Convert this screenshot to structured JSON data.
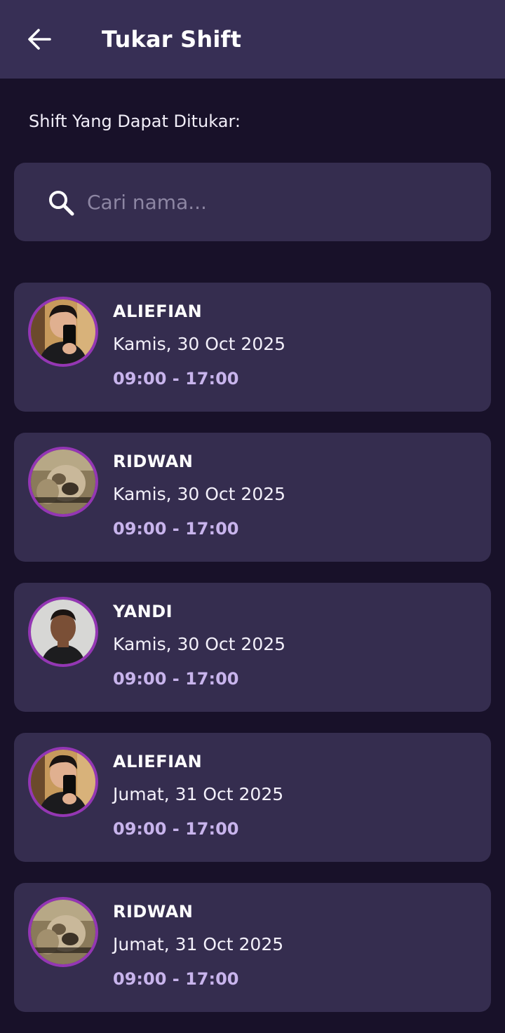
{
  "app_bar": {
    "title": "Tukar Shift",
    "back_icon": "arrow-left-icon"
  },
  "section_label": "Shift Yang Dapat Ditukar:",
  "search": {
    "placeholder": "Cari nama...",
    "value": "",
    "icon": "search-icon"
  },
  "colors": {
    "background": "#181129",
    "app_bar": "#372f55",
    "card": "#352d4f",
    "avatar_border": "#9436b4",
    "time_text": "#c8b4ec"
  },
  "shifts": [
    {
      "name": "ALIEFIAN",
      "date": "Kamis, 30 Oct 2025",
      "time": "09:00 - 17:00",
      "avatar": "man-selfie-photo"
    },
    {
      "name": "RIDWAN",
      "date": "Kamis, 30 Oct 2025",
      "time": "09:00 - 17:00",
      "avatar": "monkey-photo"
    },
    {
      "name": "YANDI",
      "date": "Kamis, 30 Oct 2025",
      "time": "09:00 - 17:00",
      "avatar": "man-portrait-photo"
    },
    {
      "name": "ALIEFIAN",
      "date": "Jumat, 31 Oct 2025",
      "time": "09:00 - 17:00",
      "avatar": "man-selfie-photo"
    },
    {
      "name": "RIDWAN",
      "date": "Jumat, 31 Oct 2025",
      "time": "09:00 - 17:00",
      "avatar": "monkey-photo"
    }
  ]
}
